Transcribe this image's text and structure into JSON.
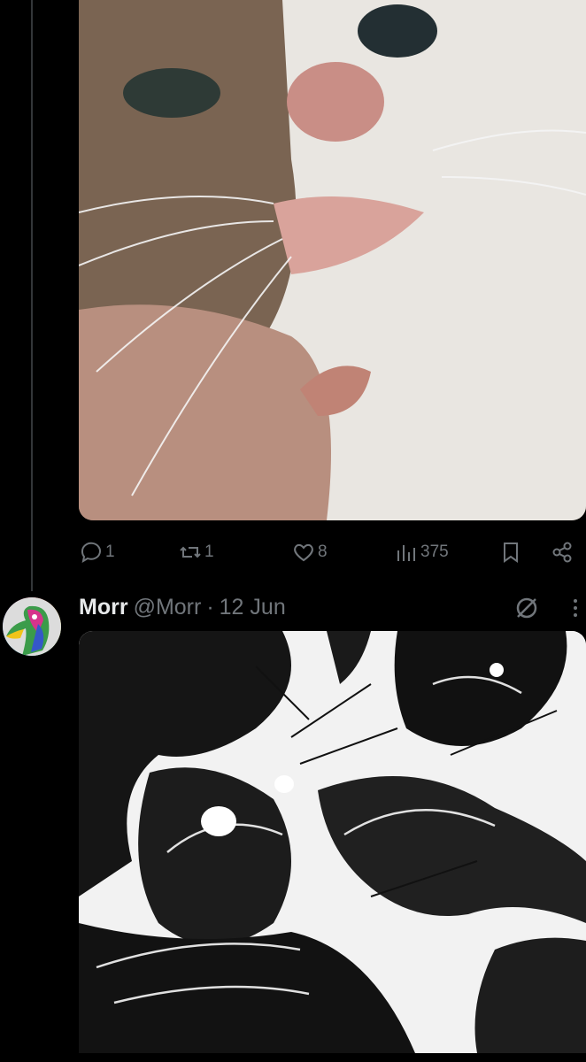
{
  "post1": {
    "media": {
      "icon": "cat-photo"
    },
    "actions": {
      "reply_count": "1",
      "repost_count": "1",
      "like_count": "8",
      "views_count": "375"
    }
  },
  "post2": {
    "author_name": "Morr",
    "author_handle": "@Morr",
    "separator": "·",
    "date": "12 Jun",
    "media": {
      "icon": "ink-drawing"
    }
  },
  "colors": {
    "background": "#000000",
    "text": "#e7e9ea",
    "muted": "#71767b",
    "thread_line": "#333639"
  }
}
